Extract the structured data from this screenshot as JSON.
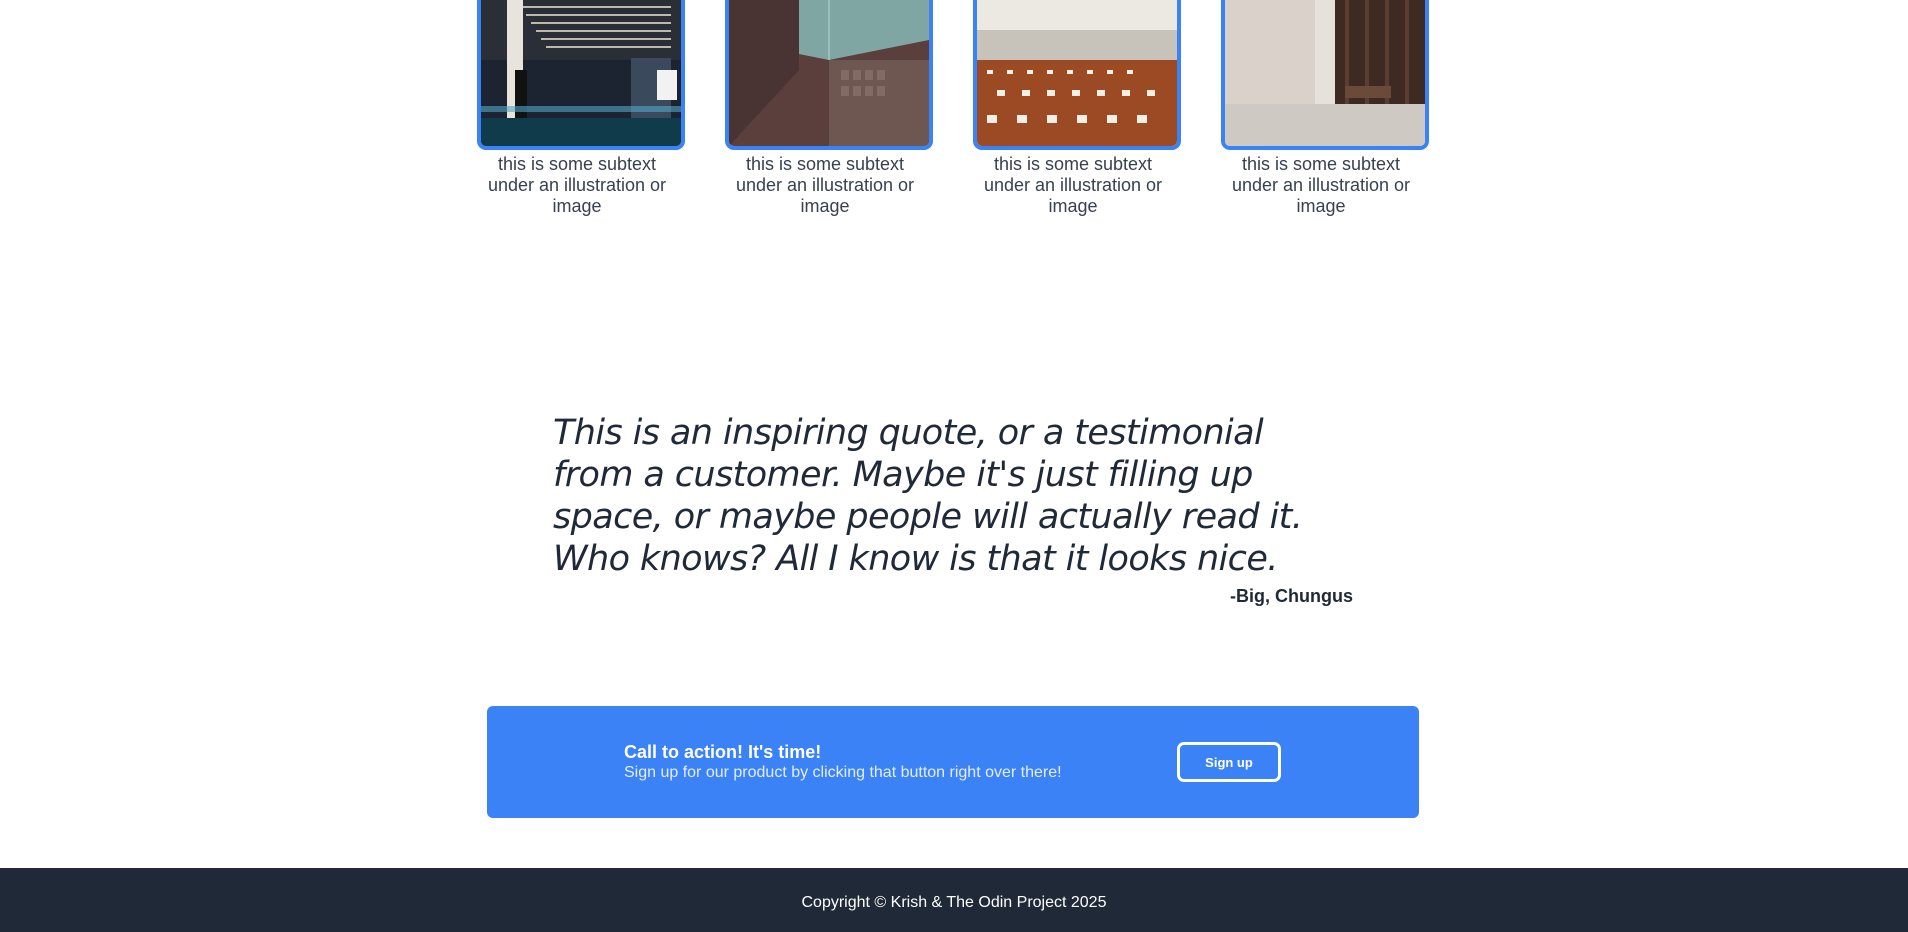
{
  "gallery": {
    "items": [
      {
        "caption": "this is some subtext under an illustration or image",
        "image": "mall-atrium-photo"
      },
      {
        "caption": "this is some subtext under an illustration or image",
        "image": "corridor-wall-photo"
      },
      {
        "caption": "this is some subtext under an illustration or image",
        "image": "tiled-hallway-photo"
      },
      {
        "caption": "this is some subtext under an illustration or image",
        "image": "lobby-bench-photo"
      }
    ]
  },
  "testimonial": {
    "quote": "This is an inspiring quote, or a testimonial from a customer. Maybe it's just filling up space, or maybe people will actually read it. Who knows? All I know is that it looks nice.",
    "author": "-Big, Chungus"
  },
  "cta": {
    "title": "Call to action! It's time!",
    "subtitle": "Sign up for our product by clicking that button right over there!",
    "button_label": "Sign up"
  },
  "footer": {
    "copyright": "Copyright © Krish & The Odin Project 2025"
  },
  "colors": {
    "accent": "#3b82f6",
    "footer_bg": "#1f2937",
    "text": "#1f2937"
  }
}
